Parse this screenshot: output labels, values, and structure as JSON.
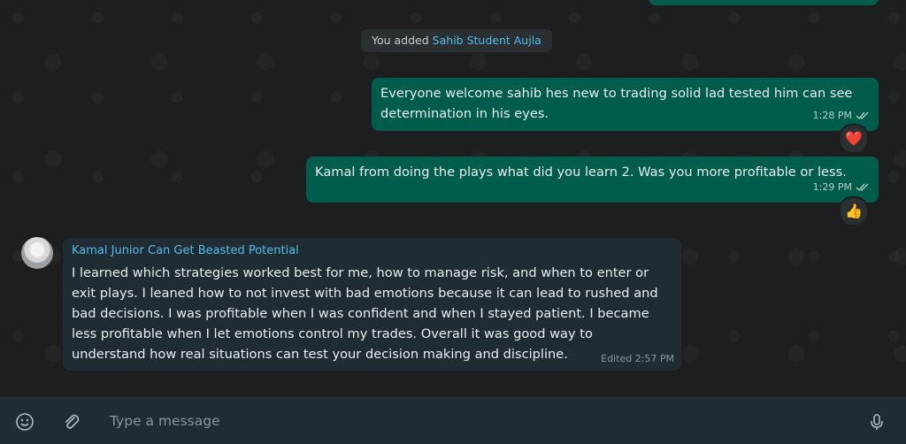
{
  "system_message": {
    "prefix": "You added",
    "name": "Sahib Student Aujla"
  },
  "messages": [
    {
      "direction": "outgoing",
      "text": "Everyone welcome sahib hes new to trading solid lad tested him can see determination in his eyes.",
      "time": "1:28 PM",
      "status": "read",
      "reaction": "❤️"
    },
    {
      "direction": "outgoing",
      "text": "Kamal from doing the plays what did you learn 2. Was you more profitable or less.",
      "time": "1:29 PM",
      "status": "read",
      "reaction": "👍"
    },
    {
      "direction": "incoming",
      "sender": "Kamal Junior Can Get Beasted Potential",
      "text": "I learned which strategies worked best for me, how to manage risk, and when to enter or exit plays. I leaned how to not invest with bad emotions because it can lead to rushed and bad decisions. I was profitable when I was confident and when I stayed patient. I became less profitable when I let emotions control my trades. Overall it was good way to understand how real situations can test your decision making and discipline.",
      "time": "Edited 2:57 PM"
    }
  ],
  "composer": {
    "placeholder": "Type a message"
  },
  "icons": {
    "emoji": "emoji-icon",
    "attach": "paperclip-icon",
    "mic": "microphone-icon",
    "ticks": "double-check-icon"
  },
  "colors": {
    "outgoing_bubble": "#005c4b",
    "incoming_bubble": "#202c33",
    "accent_name": "#53bdeb"
  }
}
